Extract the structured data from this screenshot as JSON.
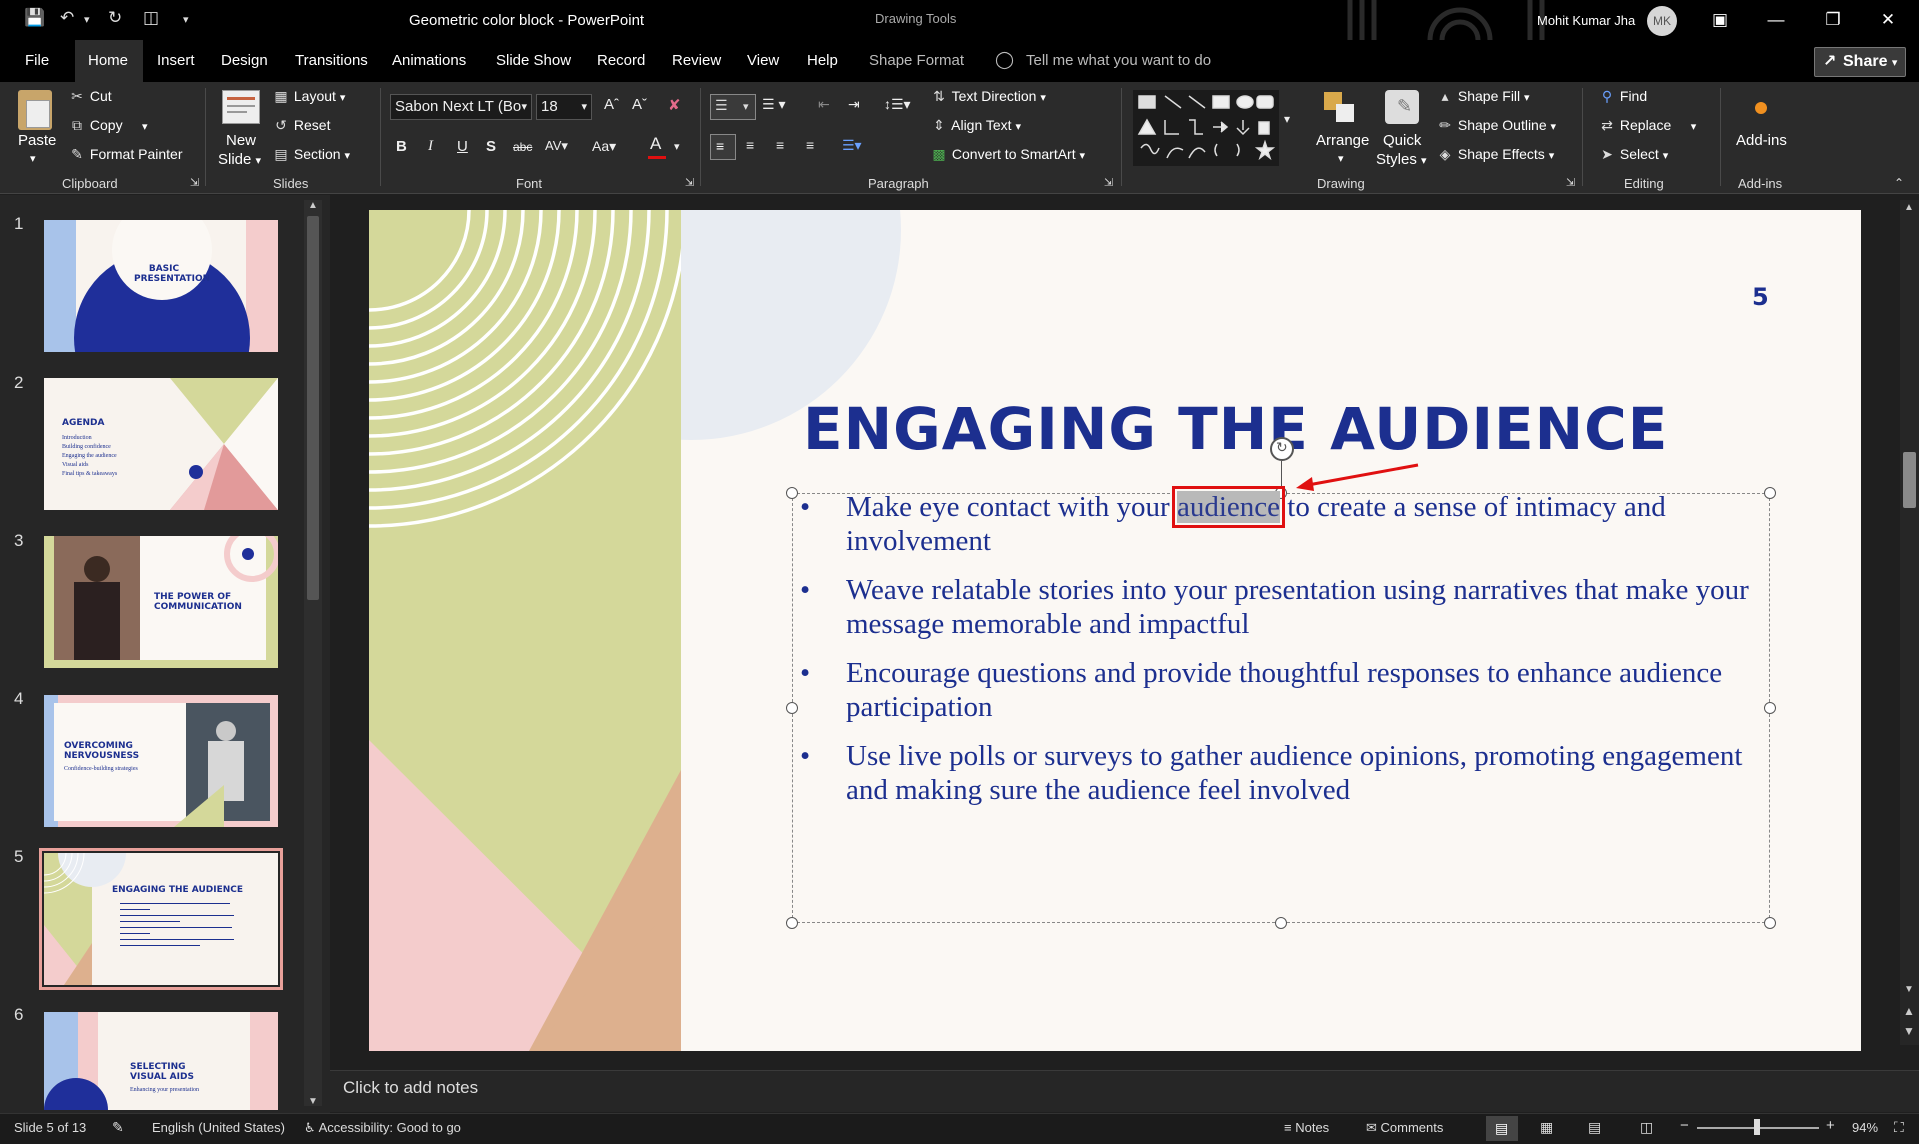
{
  "titlebar": {
    "doc_title": "Geometric color block  -  PowerPoint",
    "context_label": "Drawing Tools",
    "user_name": "Mohit Kumar Jha",
    "avatar_initials": "MK"
  },
  "tabs": [
    "File",
    "Home",
    "Insert",
    "Design",
    "Transitions",
    "Animations",
    "Slide Show",
    "Record",
    "Review",
    "View",
    "Help",
    "Shape Format"
  ],
  "tell_me": "Tell me what you want to do",
  "share": "Share",
  "ribbon": {
    "clipboard": {
      "paste": "Paste",
      "cut": "Cut",
      "copy": "Copy",
      "format_painter": "Format Painter",
      "label": "Clipboard"
    },
    "slides": {
      "new_slide_1": "New",
      "new_slide_2": "Slide",
      "layout": "Layout",
      "reset": "Reset",
      "section": "Section",
      "label": "Slides"
    },
    "font": {
      "name": "Sabon Next LT (Bo",
      "size": "18",
      "label": "Font"
    },
    "paragraph": {
      "text_direction": "Text Direction",
      "align_text": "Align Text",
      "smartart": "Convert to SmartArt",
      "label": "Paragraph"
    },
    "drawing": {
      "arrange": "Arrange",
      "quick_styles_1": "Quick",
      "quick_styles_2": "Styles",
      "shape_fill": "Shape Fill",
      "shape_outline": "Shape Outline",
      "shape_effects": "Shape Effects",
      "label": "Drawing"
    },
    "editing": {
      "find": "Find",
      "replace": "Replace",
      "select": "Select",
      "label": "Editing"
    },
    "addins": {
      "button": "Add-ins",
      "label": "Add-ins"
    }
  },
  "thumbnails": [
    {
      "num": "1",
      "title": "BASIC\nPRESENTATION"
    },
    {
      "num": "2",
      "title": "AGENDA",
      "items": [
        "Introduction",
        "Building confidence",
        "Engaging the audience",
        "Visual aids",
        "Final tips & takeaways"
      ]
    },
    {
      "num": "3",
      "title": "THE POWER OF\nCOMMUNICATION"
    },
    {
      "num": "4",
      "title": "OVERCOMING\nNERVOUSNESS",
      "subtitle": "Confidence-building strategies"
    },
    {
      "num": "5",
      "title": "ENGAGING THE AUDIENCE"
    },
    {
      "num": "6",
      "title": "SELECTING\nVISUAL AIDS",
      "subtitle": "Enhancing your presentation"
    }
  ],
  "slide": {
    "number": "5",
    "title": "ENGAGING THE AUDIENCE",
    "bullet1_pre": "Make eye contact with your ",
    "bullet1_hl": "audience",
    "bullet1_post": " to create a sense of intimacy and involvement",
    "bullet2": "Weave relatable stories into your presentation using narratives that make your message memorable and impactful",
    "bullet3": "Encourage questions and provide thoughtful responses to enhance audience participation",
    "bullet4": "Use live polls or surveys to gather audience opinions, promoting engagement and making sure the audience feel involved"
  },
  "notes_placeholder": "Click to add notes",
  "status": {
    "slide_count": "Slide 5 of 13",
    "language": "English (United States)",
    "accessibility": "Accessibility: Good to go",
    "notes": "Notes",
    "comments": "Comments",
    "zoom": "94%"
  },
  "colors": {
    "navy": "#1c2f8f",
    "olive": "#d4d89a",
    "pink": "#f4cccc",
    "tan": "#ddb08e",
    "highlight_box": "#e01010"
  }
}
